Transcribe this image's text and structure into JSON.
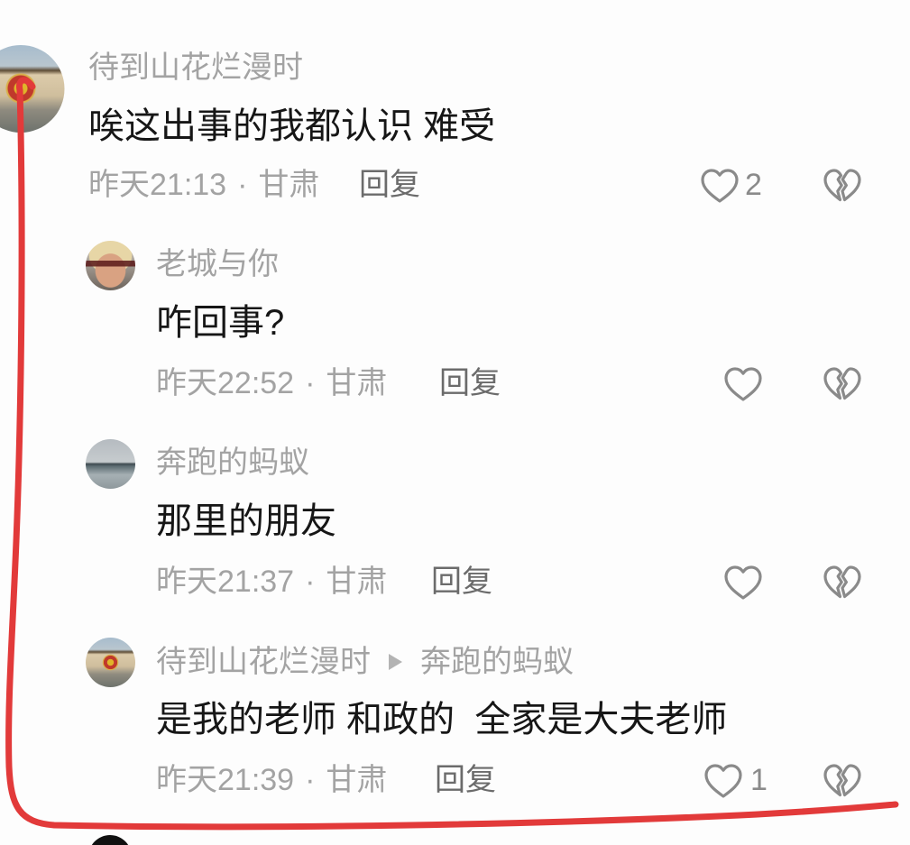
{
  "colors": {
    "background": "#fdfdfd",
    "username": "#a3a3a3",
    "comment_text": "#161616",
    "meta": "#a3a3a3",
    "reply_action": "#6b6b6b",
    "icon": "#8a8a8a",
    "annotation": "#e23a3a"
  },
  "icons": {
    "like": "heart-outline-icon",
    "dislike": "broken-heart-icon",
    "reply_to": "play-triangle-icon"
  },
  "meta_separator": "·",
  "thread": {
    "comment": {
      "username": "待到山花烂漫时",
      "text": "唉这出事的我都认识 难受",
      "time": "昨天21:13",
      "location": "甘肃",
      "reply_label": "回复",
      "like_count": "2"
    },
    "replies": [
      {
        "username": "老城与你",
        "text": "咋回事?",
        "time": "昨天22:52",
        "location": "甘肃",
        "reply_label": "回复"
      },
      {
        "username": "奔跑的蚂蚁",
        "text": "那里的朋友",
        "time": "昨天21:37",
        "location": "甘肃",
        "reply_label": "回复"
      },
      {
        "username": "待到山花烂漫时",
        "reply_to": "奔跑的蚂蚁",
        "text": "是我的老师 和政的  全家是大夫老师",
        "time": "昨天21:39",
        "location": "甘肃",
        "reply_label": "回复",
        "like_count": "1"
      }
    ]
  }
}
